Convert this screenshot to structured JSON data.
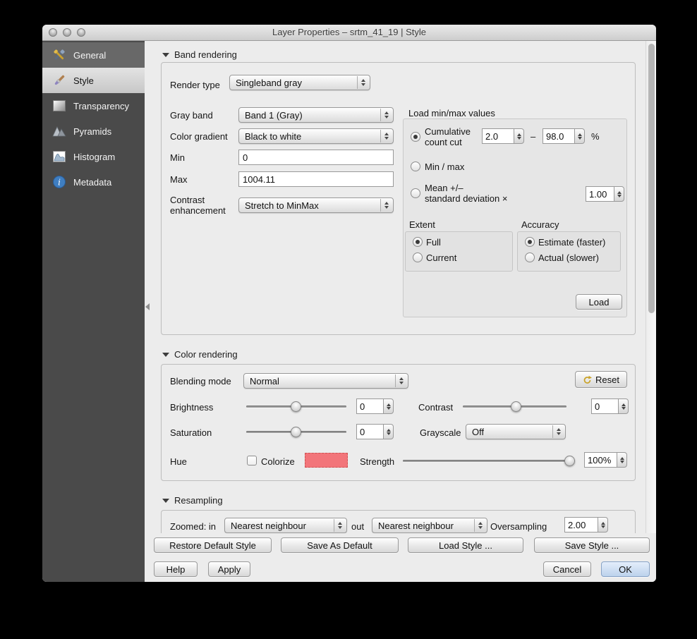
{
  "window": {
    "title": "Layer Properties – srtm_41_19 | Style"
  },
  "sidebar": {
    "items": [
      {
        "label": "General"
      },
      {
        "label": "Style"
      },
      {
        "label": "Transparency"
      },
      {
        "label": "Pyramids"
      },
      {
        "label": "Histogram"
      },
      {
        "label": "Metadata"
      }
    ]
  },
  "band": {
    "section_title": "Band rendering",
    "render_type_label": "Render type",
    "render_type_value": "Singleband gray",
    "gray_band_label": "Gray band",
    "gray_band_value": "Band 1 (Gray)",
    "color_gradient_label": "Color gradient",
    "color_gradient_value": "Black to white",
    "min_label": "Min",
    "min_value": "0",
    "max_label": "Max",
    "max_value": "1004.11",
    "contrast_enh_label": "Contrast enhancement",
    "contrast_enh_value": "Stretch to MinMax",
    "loadminmax": {
      "title": "Load min/max values",
      "cumulative_label": "Cumulative count cut",
      "cumulative_min": "2.0",
      "range_dash": "–",
      "cumulative_max": "98.0",
      "percent_suffix": "%",
      "minmax_label": "Min / max",
      "mean_label": "Mean +/–\nstandard deviation ×",
      "mean_value": "1.00",
      "extent_title": "Extent",
      "extent_full": "Full",
      "extent_current": "Current",
      "accuracy_title": "Accuracy",
      "accuracy_estimate": "Estimate (faster)",
      "accuracy_actual": "Actual (slower)",
      "load_button": "Load"
    }
  },
  "color": {
    "section_title": "Color rendering",
    "blending_label": "Blending mode",
    "blending_value": "Normal",
    "reset_button": "Reset",
    "brightness_label": "Brightness",
    "brightness_value": "0",
    "contrast_label": "Contrast",
    "contrast_value": "0",
    "saturation_label": "Saturation",
    "saturation_value": "0",
    "grayscale_label": "Grayscale",
    "grayscale_value": "Off",
    "hue_label": "Hue",
    "colorize_label": "Colorize",
    "strength_label": "Strength",
    "strength_value": "100%"
  },
  "resampling": {
    "section_title": "Resampling",
    "zoomed_in_label": "Zoomed: in",
    "zoomed_in_value": "Nearest neighbour",
    "out_label": "out",
    "zoomed_out_value": "Nearest neighbour",
    "oversampling_label": "Oversampling",
    "oversampling_value": "2.00"
  },
  "footer": {
    "restore_default": "Restore Default Style",
    "save_as_default": "Save As Default",
    "load_style": "Load Style ...",
    "save_style": "Save Style ...",
    "help": "Help",
    "apply": "Apply",
    "cancel": "Cancel",
    "ok": "OK"
  },
  "colors": {
    "colorize_swatch": "#f2757a",
    "ok_button_tint": "#bcd2ec"
  }
}
